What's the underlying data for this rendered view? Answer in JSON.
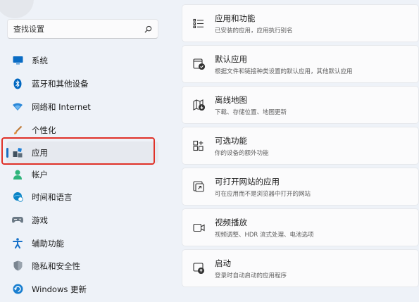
{
  "search": {
    "placeholder": "查找设置"
  },
  "sidebar": {
    "items": [
      {
        "label": "系统",
        "icon": "display-icon",
        "color": "#0a6cc4"
      },
      {
        "label": "蓝牙和其他设备",
        "icon": "bluetooth-icon",
        "color": "#0067c0"
      },
      {
        "label": "网络和 Internet",
        "icon": "wifi-icon",
        "color": "#2b88d8"
      },
      {
        "label": "个性化",
        "icon": "brush-icon",
        "color": "#e08b3a"
      },
      {
        "label": "应用",
        "icon": "apps-icon",
        "color": "#41515f",
        "selected": true,
        "highlighted": true
      },
      {
        "label": "帐户",
        "icon": "person-icon",
        "color": "#2fb47b"
      },
      {
        "label": "时间和语言",
        "icon": "globe-clock-icon",
        "color": "#0a84c6"
      },
      {
        "label": "游戏",
        "icon": "gamepad-icon",
        "color": "#6c7a86"
      },
      {
        "label": "辅助功能",
        "icon": "accessibility-icon",
        "color": "#1671c9"
      },
      {
        "label": "隐私和安全性",
        "icon": "shield-icon",
        "color": "#7a8590"
      },
      {
        "label": "Windows 更新",
        "icon": "update-icon",
        "color": "#1a7fd0"
      }
    ]
  },
  "cards": [
    {
      "title": "应用和功能",
      "desc": "已安装的应用，应用执行别名",
      "icon": "apps-list-icon"
    },
    {
      "title": "默认应用",
      "desc": "根据文件和链接种类设置的默认应用，其他默认应用",
      "icon": "default-apps-icon"
    },
    {
      "title": "离线地图",
      "desc": "下载、存储位置、地图更新",
      "icon": "offline-map-icon"
    },
    {
      "title": "可选功能",
      "desc": "你的设备的额外功能",
      "icon": "optional-features-icon"
    },
    {
      "title": "可打开网站的应用",
      "desc": "可在应用而不是浏览器中打开的网站",
      "icon": "open-website-icon"
    },
    {
      "title": "视频播放",
      "desc": "视频调整、HDR 流式处理、电池选项",
      "icon": "video-icon"
    },
    {
      "title": "启动",
      "desc": "登录时自动启动的应用程序",
      "icon": "startup-icon"
    }
  ],
  "colors": {
    "accent": "#1b6ec2",
    "highlight_border": "#e03128",
    "background": "#eef2f8"
  }
}
